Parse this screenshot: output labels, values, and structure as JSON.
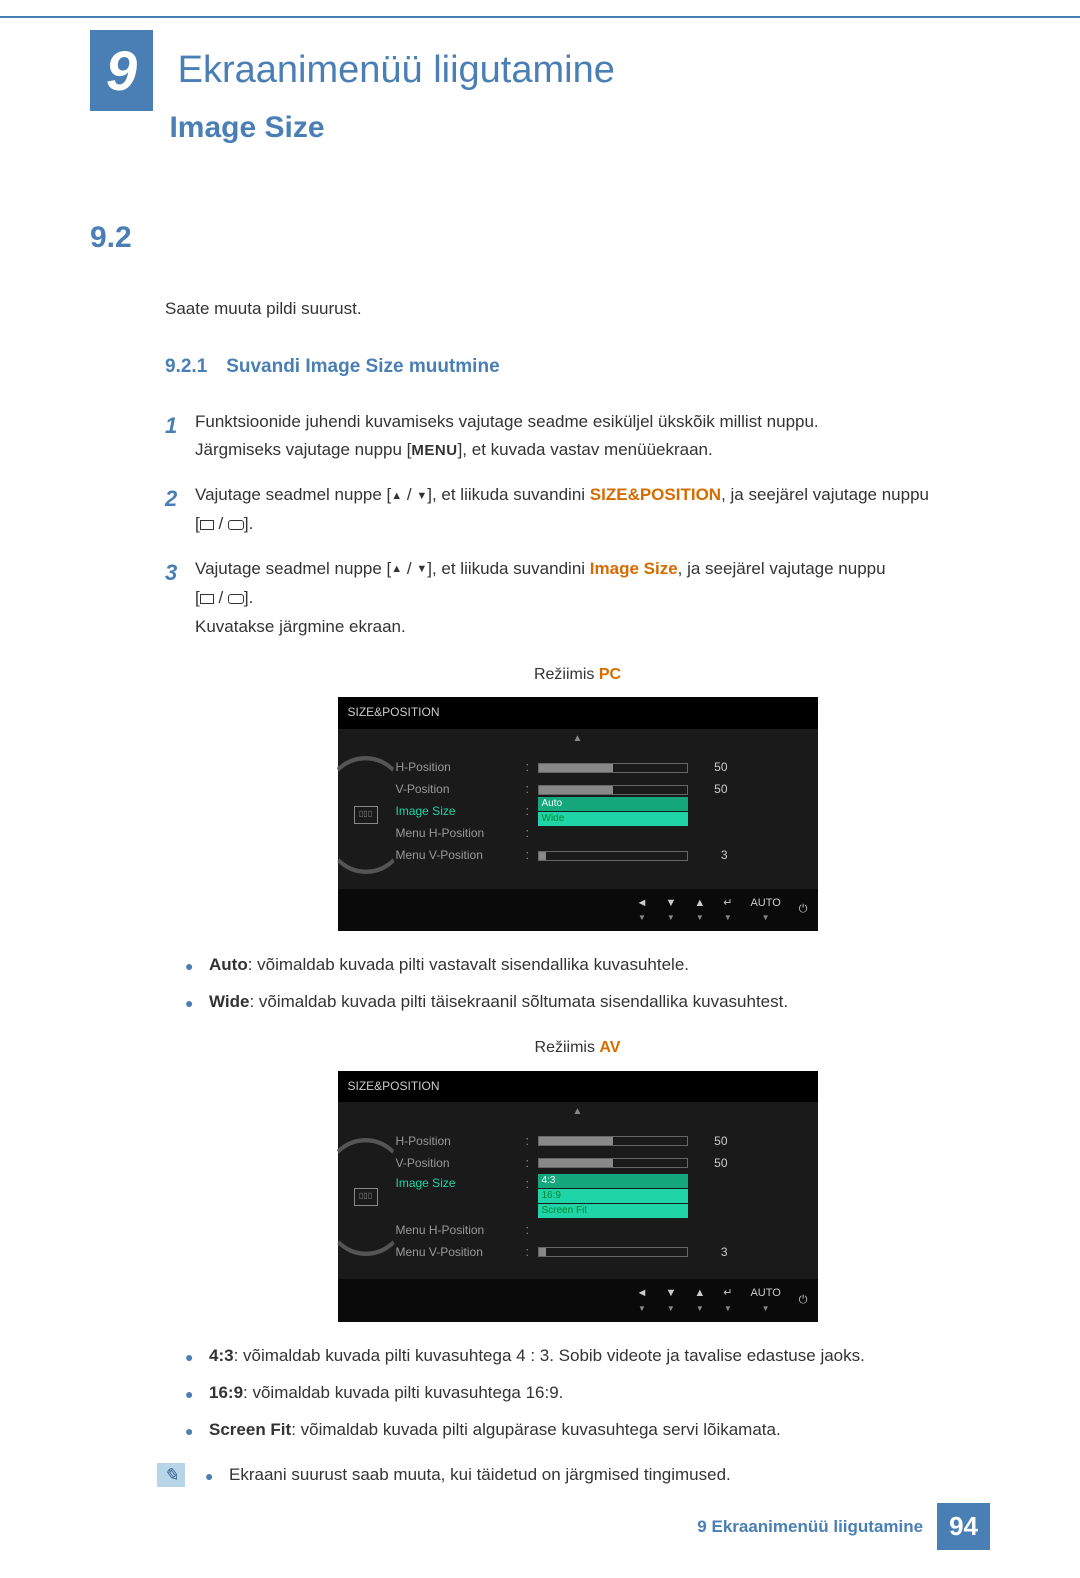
{
  "chapter": {
    "number": "9",
    "title": "Ekraanimenüü liigutamine"
  },
  "section": {
    "number": "9.2",
    "title": "Image Size",
    "intro": "Saate muuta pildi suurust."
  },
  "subsection": {
    "number": "9.2.1",
    "title": "Suvandi Image Size muutmine"
  },
  "steps": {
    "s1": "Funktsioonide juhendi kuvamiseks vajutage seadme esiküljel ükskõik millist nuppu.",
    "s1b_pre": "Järgmiseks vajutage nuppu [",
    "s1b_menu": "MENU",
    "s1b_post": "], et kuvada vastav menüüekraan.",
    "s2_pre": "Vajutage seadmel nuppe [",
    "s2_mid": "], et liikuda suvandini ",
    "s2_kw": "SIZE&POSITION",
    "s2_post": ", ja seejärel vajutage nuppu",
    "s3_pre": "Vajutage seadmel nuppe [",
    "s3_mid": "], et liikuda suvandini ",
    "s3_kw": "Image Size",
    "s3_post": ", ja seejärel vajutage nuppu",
    "s3b": "Kuvatakse järgmine ekraan."
  },
  "mode_pc": {
    "label": "Režiimis ",
    "kw": "PC"
  },
  "mode_av": {
    "label": "Režiimis ",
    "kw": "AV"
  },
  "osd": {
    "title": "SIZE&POSITION",
    "labels": {
      "hpos": "H-Position",
      "vpos": "V-Position",
      "isize": "Image Size",
      "mhpos": "Menu H-Position",
      "mvpos": "Menu V-Position"
    },
    "vals": {
      "hpos": "50",
      "vpos": "50",
      "mvpos": "3"
    },
    "pc_opts": {
      "o1": "Auto",
      "o2": "Wide"
    },
    "av_opts": {
      "o1": "4:3",
      "o2": "16:9",
      "o3": "Screen Fit"
    },
    "footer": {
      "auto": "AUTO"
    }
  },
  "bullets_pc": {
    "auto_kw": "Auto",
    "auto_txt": ": võimaldab kuvada pilti vastavalt sisendallika kuvasuhtele.",
    "wide_kw": "Wide",
    "wide_txt": ": võimaldab kuvada pilti täisekraanil sõltumata sisendallika kuvasuhtest."
  },
  "bullets_av": {
    "b1_kw": "4:3",
    "b1_txt": ": võimaldab kuvada pilti kuvasuhtega 4 : 3. Sobib videote ja tavalise edastuse jaoks.",
    "b2_kw": "16:9",
    "b2_txt": ": võimaldab kuvada pilti kuvasuhtega 16:9.",
    "b3_kw": "Screen Fit",
    "b3_txt": ": võimaldab kuvada pilti algupärase kuvasuhtega servi lõikamata."
  },
  "note": "Ekraani suurust saab muuta, kui täidetud on järgmised tingimused.",
  "footer": {
    "text": "9 Ekraanimenüü liigutamine",
    "page": "94"
  }
}
